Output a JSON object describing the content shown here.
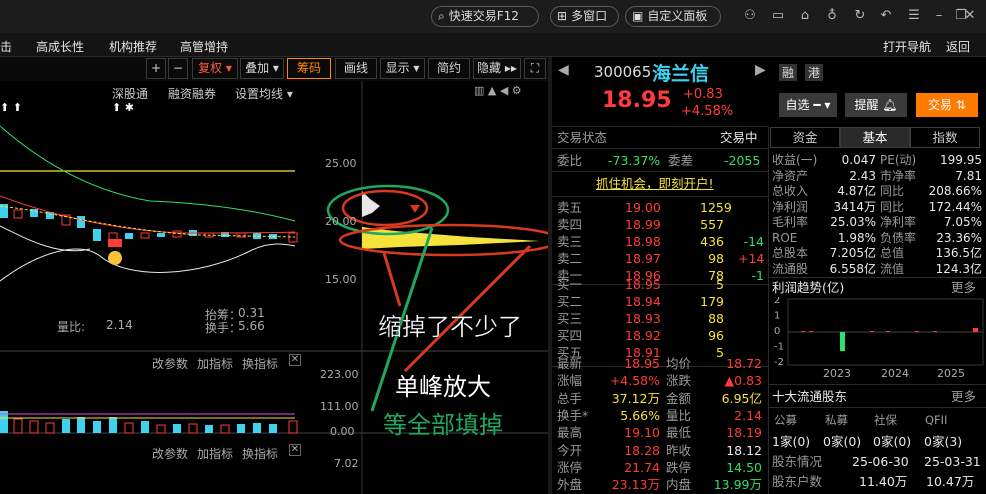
{
  "titlebar": {
    "quick_trade": "快速交易F12",
    "multi_window": "多窗口",
    "custom_panel": "自定义面板"
  },
  "menu": [
    "击",
    "高成长性",
    "机构推荐",
    "高管增持"
  ],
  "menu_right": [
    "打开导航",
    "返回"
  ],
  "toolbar": {
    "plus": "+",
    "minus": "−",
    "fuquan": "复权",
    "diejia": "叠加",
    "chouma": "筹码",
    "huaxian": "画线",
    "xianshi": "显示",
    "jianyue": "简约",
    "yincang": "隐藏"
  },
  "chart": {
    "links": [
      "深股通",
      "融资融券",
      "设置均线"
    ],
    "price_axis": [
      "25.00",
      "20.00",
      "15.00"
    ],
    "vol_label": "量比:",
    "vol_value": "2.14",
    "choupan_label": "抬筹：",
    "choupan_value": "0.31",
    "huanshou_label": "换手：",
    "huanshou_value": "5.66",
    "sub1_links": [
      "改参数",
      "加指标",
      "换指标"
    ],
    "sub1_axis": [
      "223.00",
      "111.00",
      "0.00"
    ],
    "sub2_links": [
      "改参数",
      "加指标",
      "换指标"
    ],
    "sub2_axis": [
      "7.02"
    ],
    "annotations": [
      "缩掉了不少了",
      "单峰放大",
      "等全部填掉"
    ]
  },
  "quote": {
    "code": "300065",
    "name": "海兰信",
    "price": "18.95",
    "change": "+0.83",
    "pct": "+4.58%",
    "tag1": "融",
    "tag2": "港",
    "zixuan": "自选",
    "tixing": "提醒",
    "jiaoyi": "交易"
  },
  "status": {
    "label": "交易状态",
    "value": "交易中",
    "weibi_label": "委比",
    "weibi": "-73.37%",
    "weicha_label": "委差",
    "weicha": "-2055"
  },
  "banner": "抓住机会，即刻开户!",
  "sell": [
    {
      "label": "卖五",
      "price": "19.00",
      "vol": "1259",
      "chg": ""
    },
    {
      "label": "卖四",
      "price": "18.99",
      "vol": "557",
      "chg": ""
    },
    {
      "label": "卖三",
      "price": "18.98",
      "vol": "436",
      "chg": "-14"
    },
    {
      "label": "卖二",
      "price": "18.97",
      "vol": "98",
      "chg": "+14"
    },
    {
      "label": "卖一",
      "price": "18.96",
      "vol": "78",
      "chg": "-1"
    }
  ],
  "buy": [
    {
      "label": "买一",
      "price": "18.95",
      "vol": "5"
    },
    {
      "label": "买二",
      "price": "18.94",
      "vol": "179"
    },
    {
      "label": "买三",
      "price": "18.93",
      "vol": "88"
    },
    {
      "label": "买四",
      "price": "18.92",
      "vol": "96"
    },
    {
      "label": "买五",
      "price": "18.91",
      "vol": "5"
    }
  ],
  "stats": [
    {
      "l1": "最新",
      "v1": "18.95",
      "l2": "均价",
      "v2": "18.72"
    },
    {
      "l1": "涨幅",
      "v1": "+4.58%",
      "l2": "涨跌",
      "v2": "▲0.83"
    },
    {
      "l1": "总手",
      "v1": "37.12万",
      "l2": "金额",
      "v2": "6.95亿"
    },
    {
      "l1": "换手*",
      "v1": "5.66%",
      "l2": "量比",
      "v2": "2.14"
    },
    {
      "l1": "最高",
      "v1": "19.10",
      "l2": "最低",
      "v2": "18.19"
    },
    {
      "l1": "今开",
      "v1": "18.28",
      "l2": "昨收",
      "v2": "18.12"
    },
    {
      "l1": "涨停",
      "v1": "21.74",
      "l2": "跌停",
      "v2": "14.50"
    },
    {
      "l1": "外盘",
      "v1": "23.13万",
      "l2": "内盘",
      "v2": "13.99万"
    }
  ],
  "ftabs": [
    "资金",
    "基本",
    "指数"
  ],
  "fin": [
    {
      "l1": "收益(一)",
      "v1": "0.047",
      "l2": "PE(动)",
      "v2": "199.95"
    },
    {
      "l1": "净资产",
      "v1": "2.43",
      "l2": "市净率",
      "v2": "7.81"
    },
    {
      "l1": "总收入",
      "v1": "4.87亿",
      "l2": "同比",
      "v2": "208.66%"
    },
    {
      "l1": "净利润",
      "v1": "3414万",
      "l2": "同比",
      "v2": "172.44%"
    },
    {
      "l1": "毛利率",
      "v1": "25.03%",
      "l2": "净利率",
      "v2": "7.05%"
    },
    {
      "l1": "ROE",
      "v1": "1.98%",
      "l2": "负债率",
      "v2": "23.36%"
    },
    {
      "l1": "总股本",
      "v1": "7.205亿",
      "l2": "总值",
      "v2": "136.5亿"
    },
    {
      "l1": "流通股",
      "v1": "6.558亿",
      "l2": "流值",
      "v2": "124.3亿"
    }
  ],
  "profit": {
    "title": "利润趋势(亿)",
    "more": "更多",
    "axis": [
      "2",
      "1",
      "0",
      "-1",
      "-2"
    ],
    "years": [
      "2023",
      "2024",
      "2025"
    ]
  },
  "holders": {
    "title": "十大流通股东",
    "more": "更多",
    "heads": [
      "公募",
      "私募",
      "社保",
      "QFII"
    ],
    "vals": [
      "1家(0)",
      "0家(0)",
      "0家(0)",
      "0家(3)"
    ],
    "r1": {
      "label": "股东情况",
      "d1": "25-06-30",
      "d2": "25-03-31"
    },
    "r2": {
      "label": "股东户数",
      "d1": "11.40万",
      "d2": "10.47万"
    }
  },
  "colors": {
    "up": "#ff3b3b",
    "down": "#2fe06a",
    "accent": "#ff7b00",
    "cyan": "#3fd2ef"
  }
}
